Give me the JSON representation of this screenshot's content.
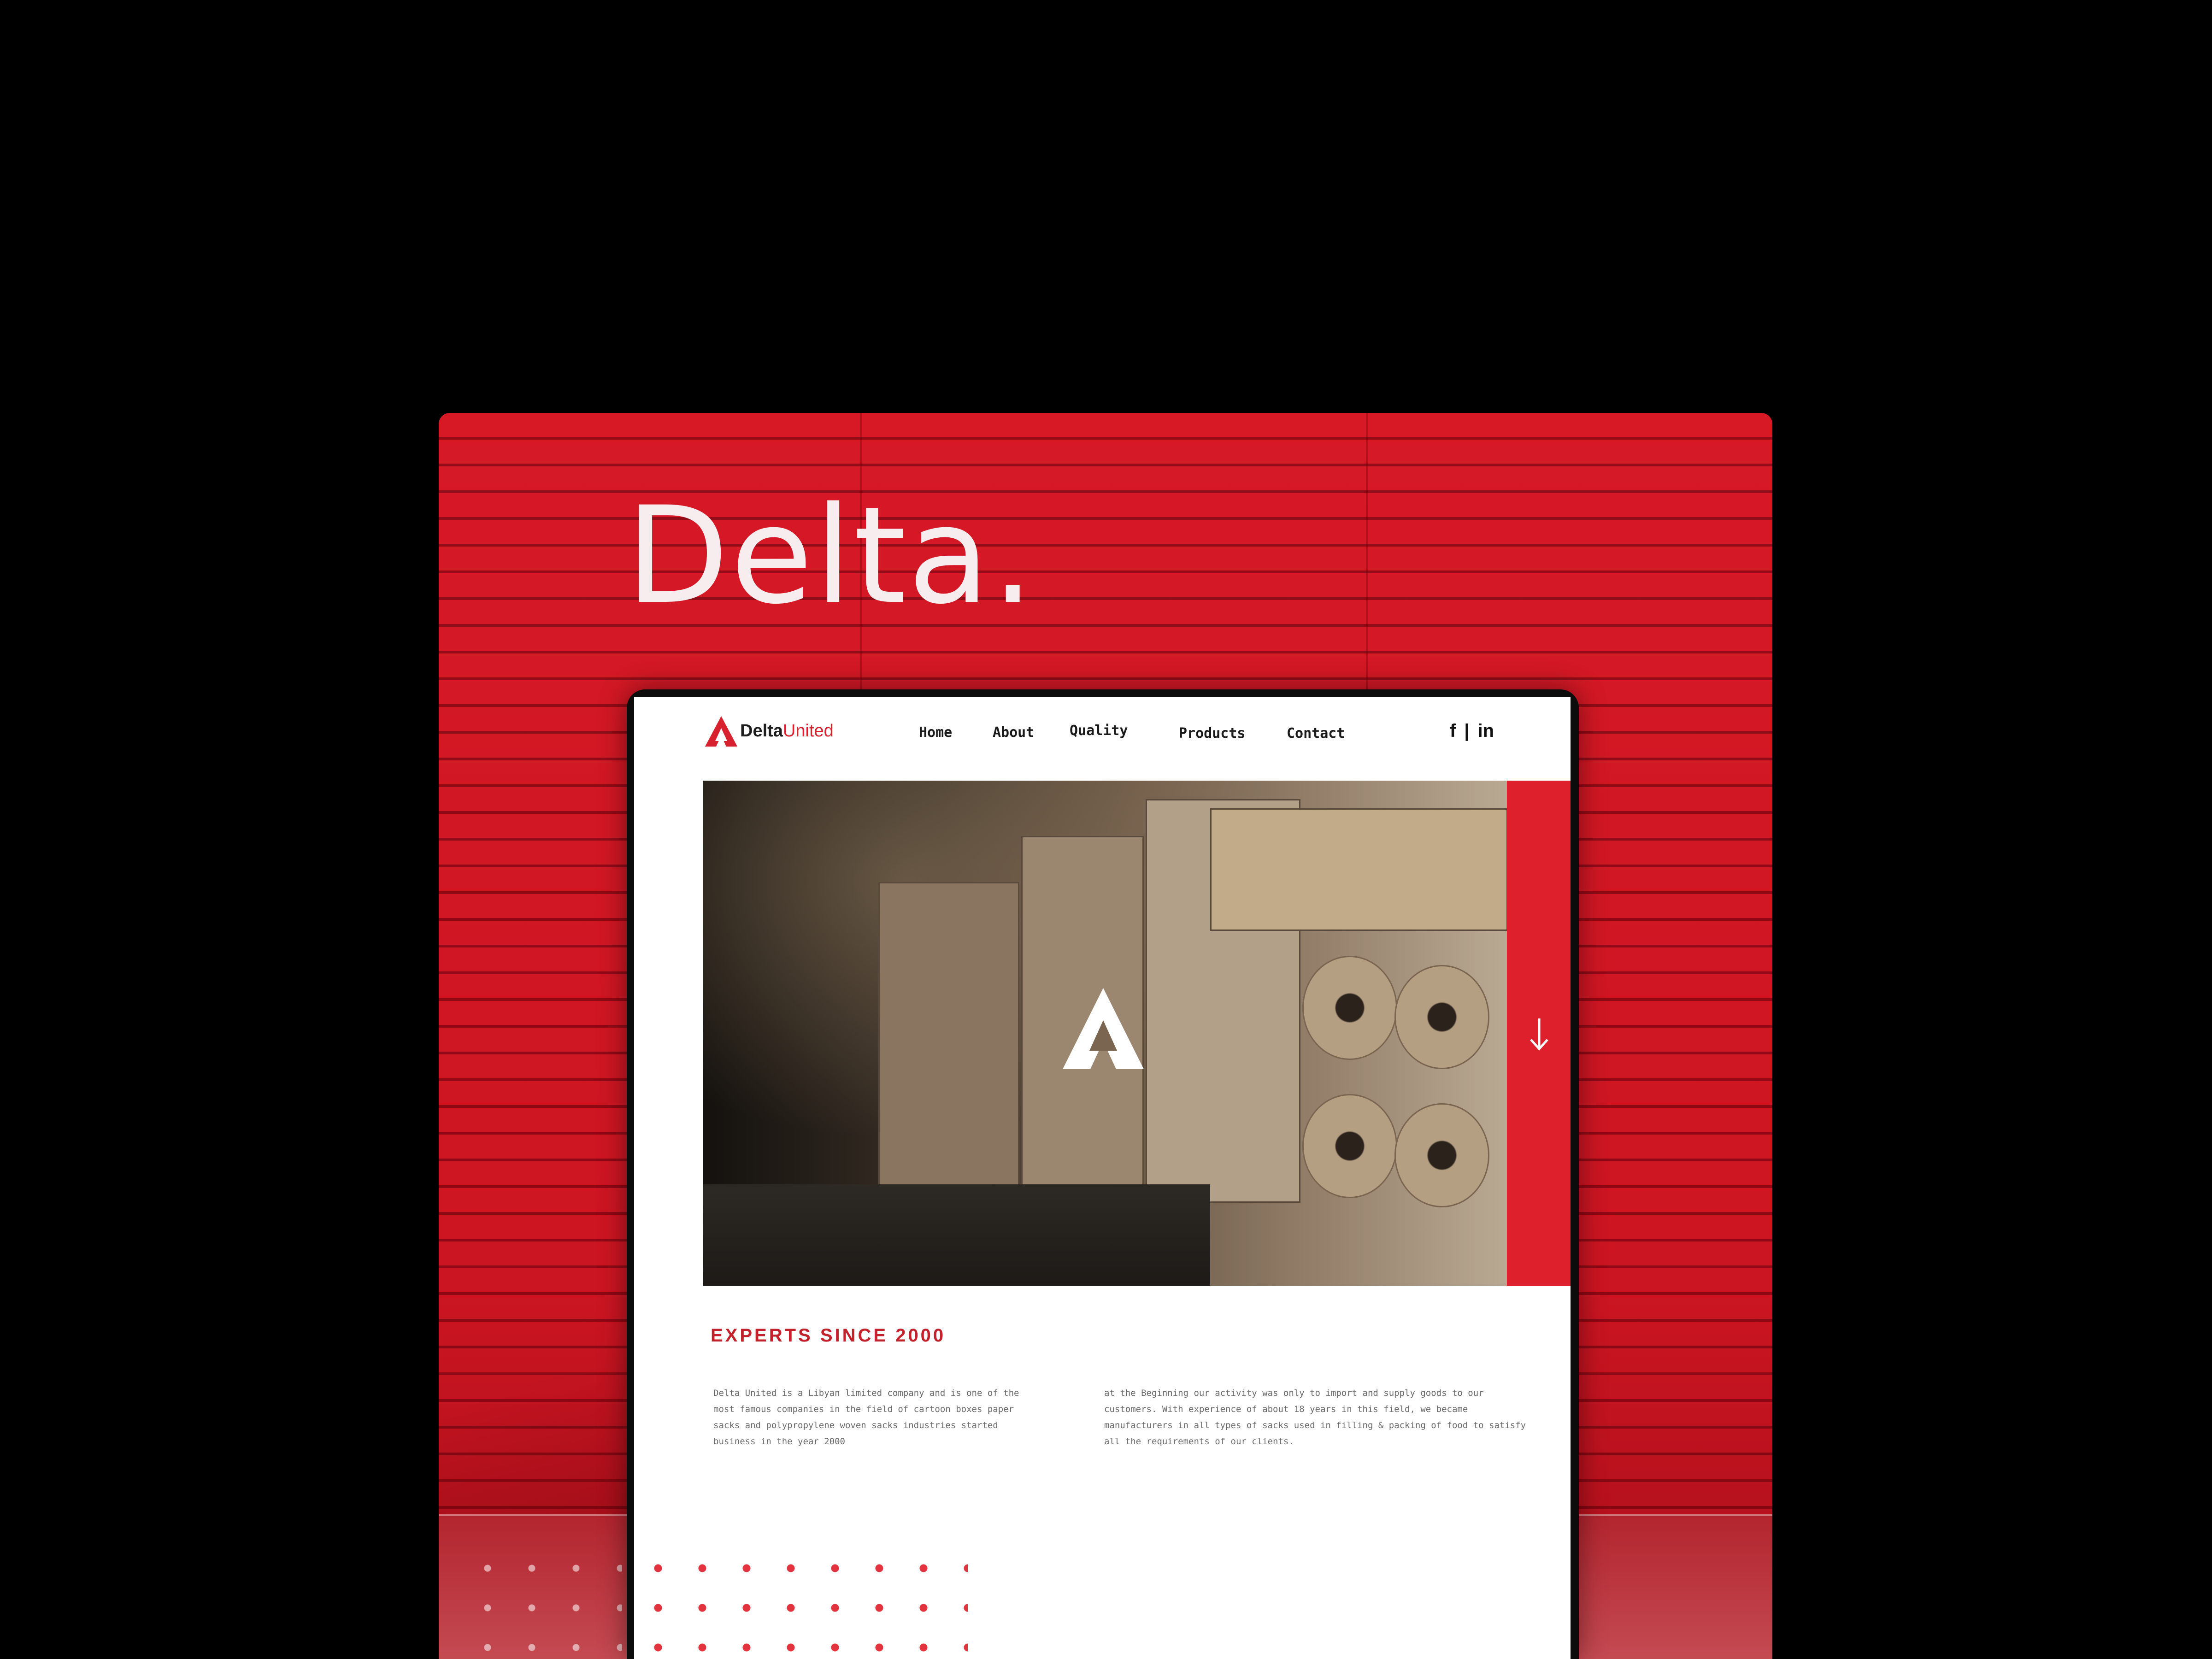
{
  "showcase": {
    "headline": "Delta.",
    "accent_color": "#d71926"
  },
  "site": {
    "logo": {
      "part1": "Delta",
      "part2": "United"
    },
    "nav": [
      "Home",
      "About",
      "Quality",
      "Products",
      "Contact"
    ],
    "social": {
      "facebook": "f",
      "separator": "|",
      "linkedin": "in"
    },
    "hero": {
      "scroll_icon": "arrow-down-icon",
      "mark_icon": "delta-logo-icon"
    },
    "about": {
      "title": "EXPERTS SINCE 2000",
      "left_text": "Delta United is a Libyan limited company and is one of the most famous companies in the field of cartoon boxes paper sacks and polypropylene woven sacks industries started business in the year 2000",
      "right_text": "at the Beginning our activity was only to import and supply goods to our customers. With experience of about 18 years in this field, we became manufacturers in all types of sacks used in filling & packing of food to satisfy all the requirements of our clients."
    },
    "brand_red": "#dd202c"
  }
}
